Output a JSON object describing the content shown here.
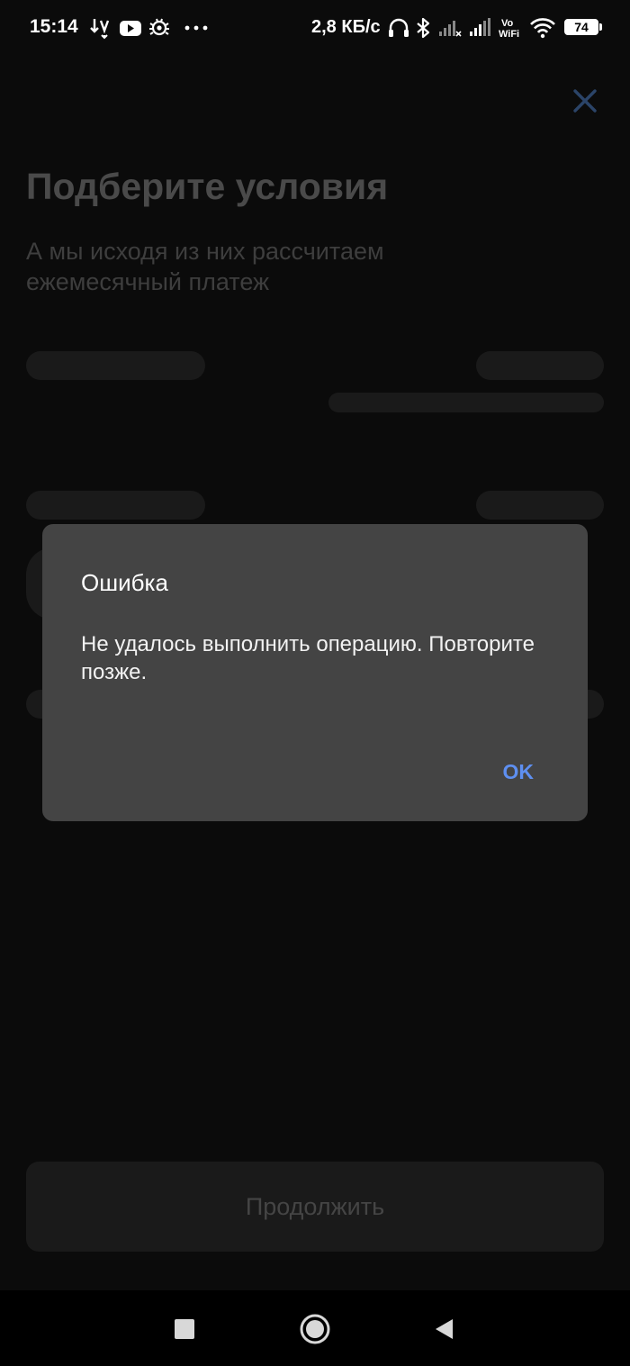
{
  "status_bar": {
    "time": "15:14",
    "network_speed": "2,8 КБ/с",
    "battery_level": "74",
    "icons": [
      "download-arrows-icon",
      "youtube-icon",
      "bug-icon",
      "more-dots-icon",
      "headset-icon",
      "bluetooth-icon",
      "cell-signal-1-icon",
      "cell-signal-2-icon",
      "vowifi-icon",
      "wifi-icon",
      "battery-icon"
    ],
    "vowifi_label": "Vo\nWiFi"
  },
  "screen": {
    "title": "Подберите условия",
    "subtitle": "А мы исходя из них рассчитаем ежемесячный платеж",
    "continue_label": "Продолжить"
  },
  "dialog": {
    "title": "Ошибка",
    "message": "Не удалось выполнить операцию. Повторите позже.",
    "ok_label": "OK"
  },
  "nav_bar": {
    "icons": [
      "recent-apps-icon",
      "home-icon",
      "back-icon"
    ]
  },
  "colors": {
    "background": "#0b0b0b",
    "dialog_bg": "#444444",
    "accent": "#5e8ff0",
    "close_icon": "#2b4468"
  }
}
